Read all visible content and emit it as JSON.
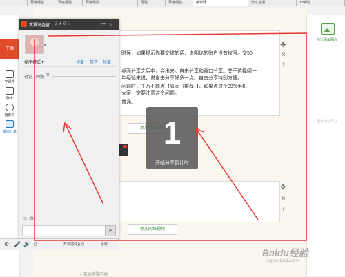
{
  "browser_tabs": [
    {
      "label": "",
      "active": false
    },
    {
      "label": "百度经验",
      "active": false
    },
    {
      "label": "百度经验",
      "active": false
    },
    {
      "label": "百度经验",
      "active": false
    },
    {
      "label": "",
      "active": false
    },
    {
      "label": "经验",
      "active": false
    },
    {
      "label": "百度经验",
      "active": false
    },
    {
      "label": "编辑器",
      "active": true
    },
    {
      "label": "分享直播",
      "active": false
    },
    {
      "label": "YY频道",
      "active": false
    }
  ],
  "chat_window": {
    "title": "大翼海盗营",
    "stats": "2 ★ 0 ♡",
    "min_btn": "—",
    "close_btn": "○",
    "avatar_caret": "▾",
    "mode": "麦序模式 ▾",
    "actions": [
      "排麦",
      "禁言",
      "抢麦"
    ],
    "tab_discuss": "讨论",
    "tab_question": "问题",
    "question_count": "(0)",
    "input_icons": "☺ ⚙",
    "send_icon": "➤"
  },
  "left_nav": {
    "top_label": "下播",
    "items": [
      {
        "label": "字课件"
      },
      {
        "label": "聊卡"
      },
      {
        "label": "摄像头"
      },
      {
        "label": "桌面分享",
        "active": true
      }
    ]
  },
  "bottom_tools": {
    "icons": [
      "⚙",
      "🎤",
      "🔊",
      "♫"
    ],
    "open_interactive": "开启插件互动",
    "record": "录像"
  },
  "editor": {
    "para_lines": [
      "时候，如果提示你要交钱的话，说明你的账户没有权限。交50",
      "桌面分享之后中，会出来。自由分享和窗口分享。关于选择哪一",
      "年经验来说，说自由分享好多一点。自由分享特别方便。",
      "问题时，千万不能点【原画（推荐）】，如果点这个99%手机",
      "大家一定要注意这个问题。",
      "普通。"
    ],
    "add_video_label": "添加网络视频",
    "add_video_label2": "添加网络视频",
    "move_icon": "✥",
    "close_icon": "×",
    "add_icon": "+",
    "bottom_add": "+ 添加步骤内容"
  },
  "countdown": {
    "number": "1",
    "label": "开始分享倒计时"
  },
  "right_panel": {
    "upload_label": "点击添加图片",
    "hint_label": "图片建议尺寸"
  },
  "watermark": {
    "text": "Baidu经验",
    "sub": "jingyan.baidu.com"
  },
  "colors": {
    "annotation_red": "#e53935",
    "accent_green": "#3a8a3a",
    "nav_orange": "#e04b2a"
  }
}
